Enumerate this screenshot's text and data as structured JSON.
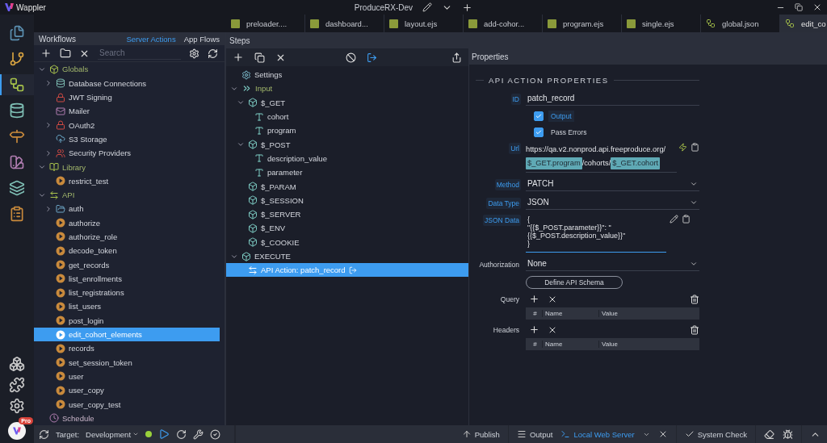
{
  "title_bar": {
    "app": "Wappler",
    "project": "ProduceRX-Dev"
  },
  "tabs": [
    {
      "label": "preloader....",
      "kind": "js",
      "selected": false
    },
    {
      "label": "dashboard...",
      "kind": "js",
      "selected": false
    },
    {
      "label": "layout.ejs",
      "kind": "js",
      "selected": false
    },
    {
      "label": "add-cohor...",
      "kind": "js",
      "selected": false
    },
    {
      "label": "program.ejs",
      "kind": "js",
      "selected": false
    },
    {
      "label": "single.ejs",
      "kind": "js",
      "selected": false
    },
    {
      "label": "global.json",
      "kind": "flow",
      "selected": false
    },
    {
      "label": "edit_co",
      "kind": "flow",
      "selected": true
    }
  ],
  "rail": [
    {
      "kind": "files",
      "selected": false
    },
    {
      "kind": "git",
      "selected": false
    },
    {
      "kind": "workflows",
      "selected": true
    },
    {
      "kind": "database",
      "selected": false
    },
    {
      "kind": "routing",
      "selected": false
    },
    {
      "kind": "design",
      "selected": false
    },
    {
      "kind": "layers",
      "selected": false
    },
    {
      "kind": "tasks",
      "selected": false
    }
  ],
  "account_badge": "Pro",
  "workflows": {
    "title": "Workflows",
    "views": [
      {
        "label": "Server Actions",
        "selected": true
      },
      {
        "label": "App Flows",
        "selected": false
      }
    ],
    "search_placeholder": "Search",
    "tree": [
      {
        "label": "Globals",
        "kind": "globals",
        "expanded": true,
        "selected": false,
        "children": [
          {
            "label": "Database Connections",
            "kind": "database",
            "expanded": false,
            "selected": false
          },
          {
            "label": "JWT Signing",
            "kind": "lock",
            "selected": false
          },
          {
            "label": "Mailer",
            "kind": "mail",
            "selected": false
          },
          {
            "label": "OAuth2",
            "kind": "lock",
            "expanded": false,
            "selected": false
          },
          {
            "label": "S3 Storage",
            "kind": "cloud",
            "selected": false
          },
          {
            "label": "Security Providers",
            "kind": "users",
            "expanded": false,
            "selected": false
          }
        ]
      },
      {
        "label": "Library",
        "kind": "library",
        "expanded": true,
        "selected": false,
        "children": [
          {
            "label": "restrict_test",
            "kind": "action",
            "selected": false
          }
        ]
      },
      {
        "label": "API",
        "kind": "api",
        "expanded": true,
        "selected": false,
        "children": [
          {
            "label": "auth",
            "kind": "folder",
            "expanded": false,
            "selected": false
          },
          {
            "label": "authorize",
            "kind": "action",
            "selected": false
          },
          {
            "label": "authorize_role",
            "kind": "action",
            "selected": false
          },
          {
            "label": "decode_token",
            "kind": "action",
            "selected": false
          },
          {
            "label": "get_records",
            "kind": "action",
            "selected": false
          },
          {
            "label": "list_enrollments",
            "kind": "action",
            "selected": false
          },
          {
            "label": "list_registrations",
            "kind": "action",
            "selected": false
          },
          {
            "label": "list_users",
            "kind": "action",
            "selected": false
          },
          {
            "label": "post_login",
            "kind": "action",
            "selected": false
          },
          {
            "label": "edit_cohort_elements",
            "kind": "action",
            "selected": true
          },
          {
            "label": "records",
            "kind": "action",
            "selected": false
          },
          {
            "label": "set_session_token",
            "kind": "action",
            "selected": false
          },
          {
            "label": "user",
            "kind": "action",
            "selected": false
          },
          {
            "label": "user_copy",
            "kind": "action",
            "selected": false
          },
          {
            "label": "user_copy_test",
            "kind": "action",
            "selected": false
          }
        ]
      },
      {
        "label": "Schedule",
        "kind": "schedule",
        "selected": false
      }
    ]
  },
  "steps": {
    "title": "Steps",
    "tree": [
      {
        "label": "Settings",
        "kind": "settings",
        "selected": false
      },
      {
        "label": "Input",
        "kind": "input",
        "expanded": true,
        "selected": false,
        "children": [
          {
            "label": "$_GET",
            "kind": "object",
            "expanded": true,
            "selected": false,
            "children": [
              {
                "label": "cohort",
                "kind": "text",
                "selected": false
              },
              {
                "label": "program",
                "kind": "text",
                "selected": false
              }
            ]
          },
          {
            "label": "$_POST",
            "kind": "object",
            "expanded": true,
            "selected": false,
            "children": [
              {
                "label": "description_value",
                "kind": "text",
                "selected": false
              },
              {
                "label": "parameter",
                "kind": "text",
                "selected": false
              }
            ]
          },
          {
            "label": "$_PARAM",
            "kind": "object",
            "selected": false
          },
          {
            "label": "$_SESSION",
            "kind": "object",
            "selected": false
          },
          {
            "label": "$_SERVER",
            "kind": "object",
            "selected": false
          },
          {
            "label": "$_ENV",
            "kind": "object",
            "selected": false
          },
          {
            "label": "$_COOKIE",
            "kind": "object",
            "selected": false
          }
        ]
      },
      {
        "label": "EXECUTE",
        "kind": "execute",
        "expanded": true,
        "selected": false,
        "children": [
          {
            "label": "API Action: patch_record",
            "kind": "api_action",
            "selected": true
          }
        ]
      }
    ]
  },
  "properties": {
    "title": "Properties",
    "section": "API ACTION PROPERTIES",
    "fields": [
      {
        "kind": "text",
        "label": "ID",
        "highlighted": true,
        "value": "patch_record"
      },
      {
        "kind": "checkbox",
        "label": "Output",
        "checked": true,
        "highlighted": true
      },
      {
        "kind": "checkbox",
        "label": "Pass Errors",
        "checked": true,
        "highlighted": false
      },
      {
        "kind": "url",
        "label": "Url",
        "highlighted": true,
        "parts": [
          {
            "kind": "text",
            "text": "https://qa.v2.nonprod.api.freeproduce.org/"
          },
          {
            "kind": "binding",
            "text": "$_GET.program"
          },
          {
            "kind": "text",
            "text": "/cohorts/"
          },
          {
            "kind": "binding",
            "text": "$_GET.cohort"
          }
        ]
      },
      {
        "kind": "select",
        "label": "Method",
        "highlighted": true,
        "value": "PATCH"
      },
      {
        "kind": "select",
        "label": "Data Type",
        "highlighted": true,
        "value": "JSON"
      },
      {
        "kind": "code",
        "label": "JSON Data",
        "highlighted": true,
        "lines": [
          "{",
          "  \"{{$_POST.parameter}}\": \"",
          "{{$_POST.description_value}}\"",
          "}"
        ]
      },
      {
        "kind": "select",
        "label": "Authorization",
        "highlighted": false,
        "value": "None"
      },
      {
        "kind": "button",
        "label": "Define API Schema"
      },
      {
        "kind": "table",
        "label": "Query",
        "columns": [
          "#",
          "Name",
          "Value"
        ]
      },
      {
        "kind": "table",
        "label": "Headers",
        "columns": [
          "#",
          "Name",
          "Value"
        ]
      }
    ]
  },
  "bottom_bar": {
    "target_label": "Target:",
    "target": "Development",
    "publish": "Publish",
    "panels": [
      {
        "kind": "output",
        "label": "Output",
        "selected": false
      },
      {
        "kind": "terminal",
        "label": "Local Web Server",
        "selected": true
      }
    ],
    "system_check": "System Check"
  }
}
